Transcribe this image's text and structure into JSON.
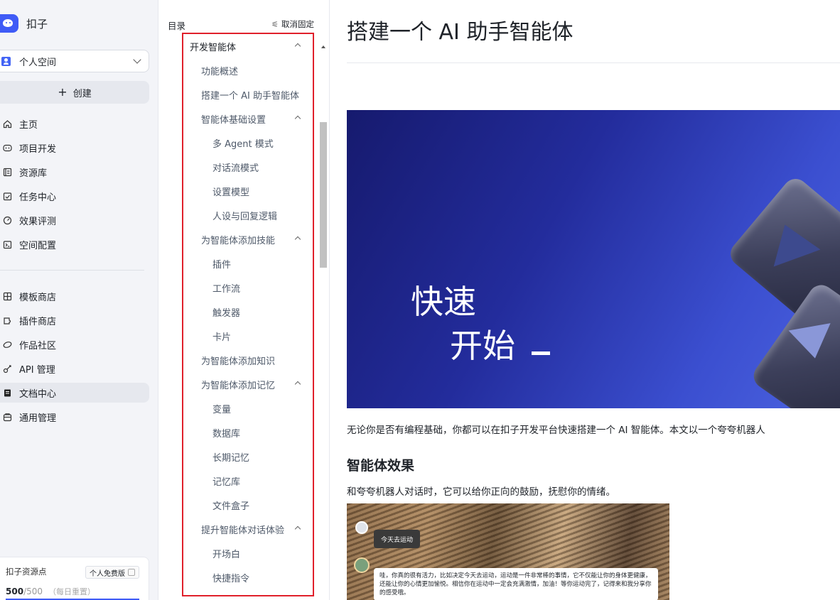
{
  "brand": {
    "name": "扣子"
  },
  "space": {
    "label": "个人空间"
  },
  "create": {
    "label": "创建"
  },
  "nav_main": [
    {
      "label": "主页",
      "icon": "home-icon"
    },
    {
      "label": "项目开发",
      "icon": "project-icon"
    },
    {
      "label": "资源库",
      "icon": "library-icon"
    },
    {
      "label": "任务中心",
      "icon": "task-icon"
    },
    {
      "label": "效果评测",
      "icon": "evaluation-icon"
    },
    {
      "label": "空间配置",
      "icon": "space-config-icon"
    }
  ],
  "nav_secondary": [
    {
      "label": "模板商店",
      "icon": "template-icon"
    },
    {
      "label": "插件商店",
      "icon": "plugin-icon"
    },
    {
      "label": "作品社区",
      "icon": "community-icon"
    },
    {
      "label": "API 管理",
      "icon": "api-icon"
    },
    {
      "label": "文档中心",
      "icon": "doc-icon",
      "active": true
    },
    {
      "label": "通用管理",
      "icon": "settings-icon"
    }
  ],
  "credits": {
    "title": "扣子资源点",
    "plan": "个人免费版",
    "current": "500",
    "total": "/500",
    "note": "（每日重置）"
  },
  "toc": {
    "title": "目录",
    "unpin": "取消固定",
    "items": [
      {
        "label": "开发智能体",
        "level": 0,
        "expanded": true
      },
      {
        "label": "功能概述",
        "level": 1
      },
      {
        "label": "搭建一个 AI 助手智能体",
        "level": 1
      },
      {
        "label": "智能体基础设置",
        "level": 1,
        "expanded": true
      },
      {
        "label": "多 Agent 模式",
        "level": 2
      },
      {
        "label": "对话流模式",
        "level": 2
      },
      {
        "label": "设置模型",
        "level": 2
      },
      {
        "label": "人设与回复逻辑",
        "level": 2
      },
      {
        "label": "为智能体添加技能",
        "level": 1,
        "expanded": true
      },
      {
        "label": "插件",
        "level": 2
      },
      {
        "label": "工作流",
        "level": 2
      },
      {
        "label": "触发器",
        "level": 2
      },
      {
        "label": "卡片",
        "level": 2
      },
      {
        "label": "为智能体添加知识",
        "level": 1
      },
      {
        "label": "为智能体添加记忆",
        "level": 1,
        "expanded": true
      },
      {
        "label": "变量",
        "level": 2
      },
      {
        "label": "数据库",
        "level": 2
      },
      {
        "label": "长期记忆",
        "level": 2
      },
      {
        "label": "记忆库",
        "level": 2
      },
      {
        "label": "文件盒子",
        "level": 2
      },
      {
        "label": "提升智能体对话体验",
        "level": 1,
        "expanded": true
      },
      {
        "label": "开场白",
        "level": 2
      },
      {
        "label": "快捷指令",
        "level": 2
      }
    ]
  },
  "article": {
    "title": "搭建一个 AI 助手智能体",
    "hero_line1": "快速",
    "hero_line2": "开始",
    "intro": "无论你是否有编程基础，你都可以在扣子开发平台快速搭建一个 AI 智能体。本文以一个夸夸机器人",
    "section_title": "智能体效果",
    "section_desc": "和夸夸机器人对话时，它可以给你正向的鼓励，抚慰你的情绪。",
    "demo_user_msg": "今天去运动",
    "demo_bot_msg": "哇，你真的很有活力，比如决定今天去运动，运动是一件非常棒的事情，它不仅能让你的身体更健康，还能让你的心情更加愉悦。相信你在运动中一定会充满激情，加油！等你运动完了，记得来和我分享你的感受哦。"
  }
}
